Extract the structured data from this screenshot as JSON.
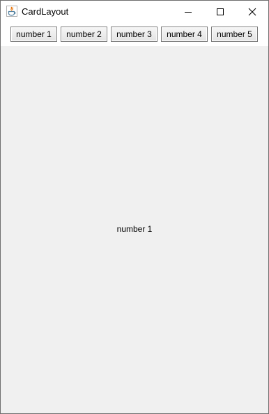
{
  "window": {
    "title": "CardLayout",
    "icon": "java-icon",
    "controls": [
      "minimize-icon",
      "maximize-icon",
      "close-icon"
    ]
  },
  "button_bar": {
    "buttons": [
      {
        "label": "number 1"
      },
      {
        "label": "number 2"
      },
      {
        "label": "number 3"
      },
      {
        "label": "number 4"
      },
      {
        "label": "number 5"
      }
    ]
  },
  "card": {
    "visible_label": "number 1"
  },
  "colors": {
    "panel_bg": "#f0f0f0",
    "titlebar_bg": "#ffffff",
    "button_border": "#7a7a7a"
  }
}
